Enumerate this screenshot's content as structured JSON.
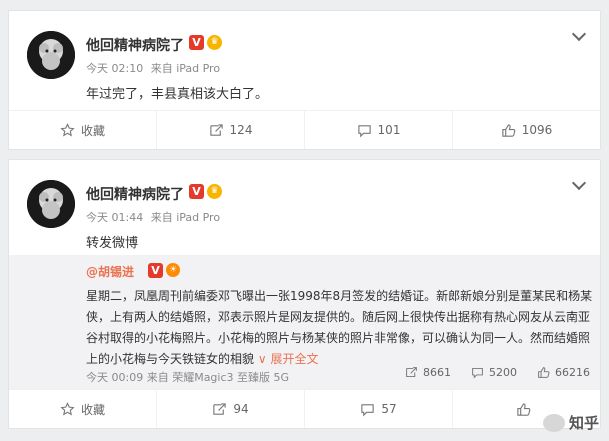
{
  "posts": [
    {
      "author": "他回精神病院了",
      "time": "今天 02:10",
      "source": "来自 iPad Pro",
      "text": "年过完了，丰县真相该大白了。",
      "actions": {
        "favorite": "收藏",
        "repost": "124",
        "comment": "101",
        "like": "1096"
      }
    },
    {
      "author": "他回精神病院了",
      "time": "今天 01:44",
      "source": "来自 iPad Pro",
      "text": "转发微博",
      "repost": {
        "user": "@胡锡进",
        "text": "星期二，凤凰周刊前编委邓飞曝出一张1998年8月签发的结婚证。新郎新娘分别是董某民和杨某侠，上有两人的结婚照，邓表示照片是网友提供的。随后网上很快传出据称有热心网友从云南亚谷村取得的小花梅照片。小花梅的照片与杨某侠的照片非常像，可以确认为同一人。然而结婚照上的小花梅与今天铁链女的相貌",
        "expand": "展开全文",
        "time": "今天 00:09",
        "source": "来自 荣耀Magic3 至臻版 5G",
        "stats": {
          "repost": "8661",
          "comment": "5200",
          "like": "66216"
        }
      },
      "actions": {
        "favorite": "收藏",
        "repost": "94",
        "comment": "57",
        "like": ""
      }
    }
  ],
  "watermark": "知乎",
  "icons": [
    "star-icon",
    "repost-icon",
    "comment-icon",
    "thumbs-up-icon",
    "chevron-down-icon",
    "verified-icon",
    "vip-icon"
  ],
  "colors": {
    "accent": "#eb7350",
    "background": "#eceeef",
    "repost_bg": "#f2f2f5",
    "verified": "#e4392b"
  }
}
